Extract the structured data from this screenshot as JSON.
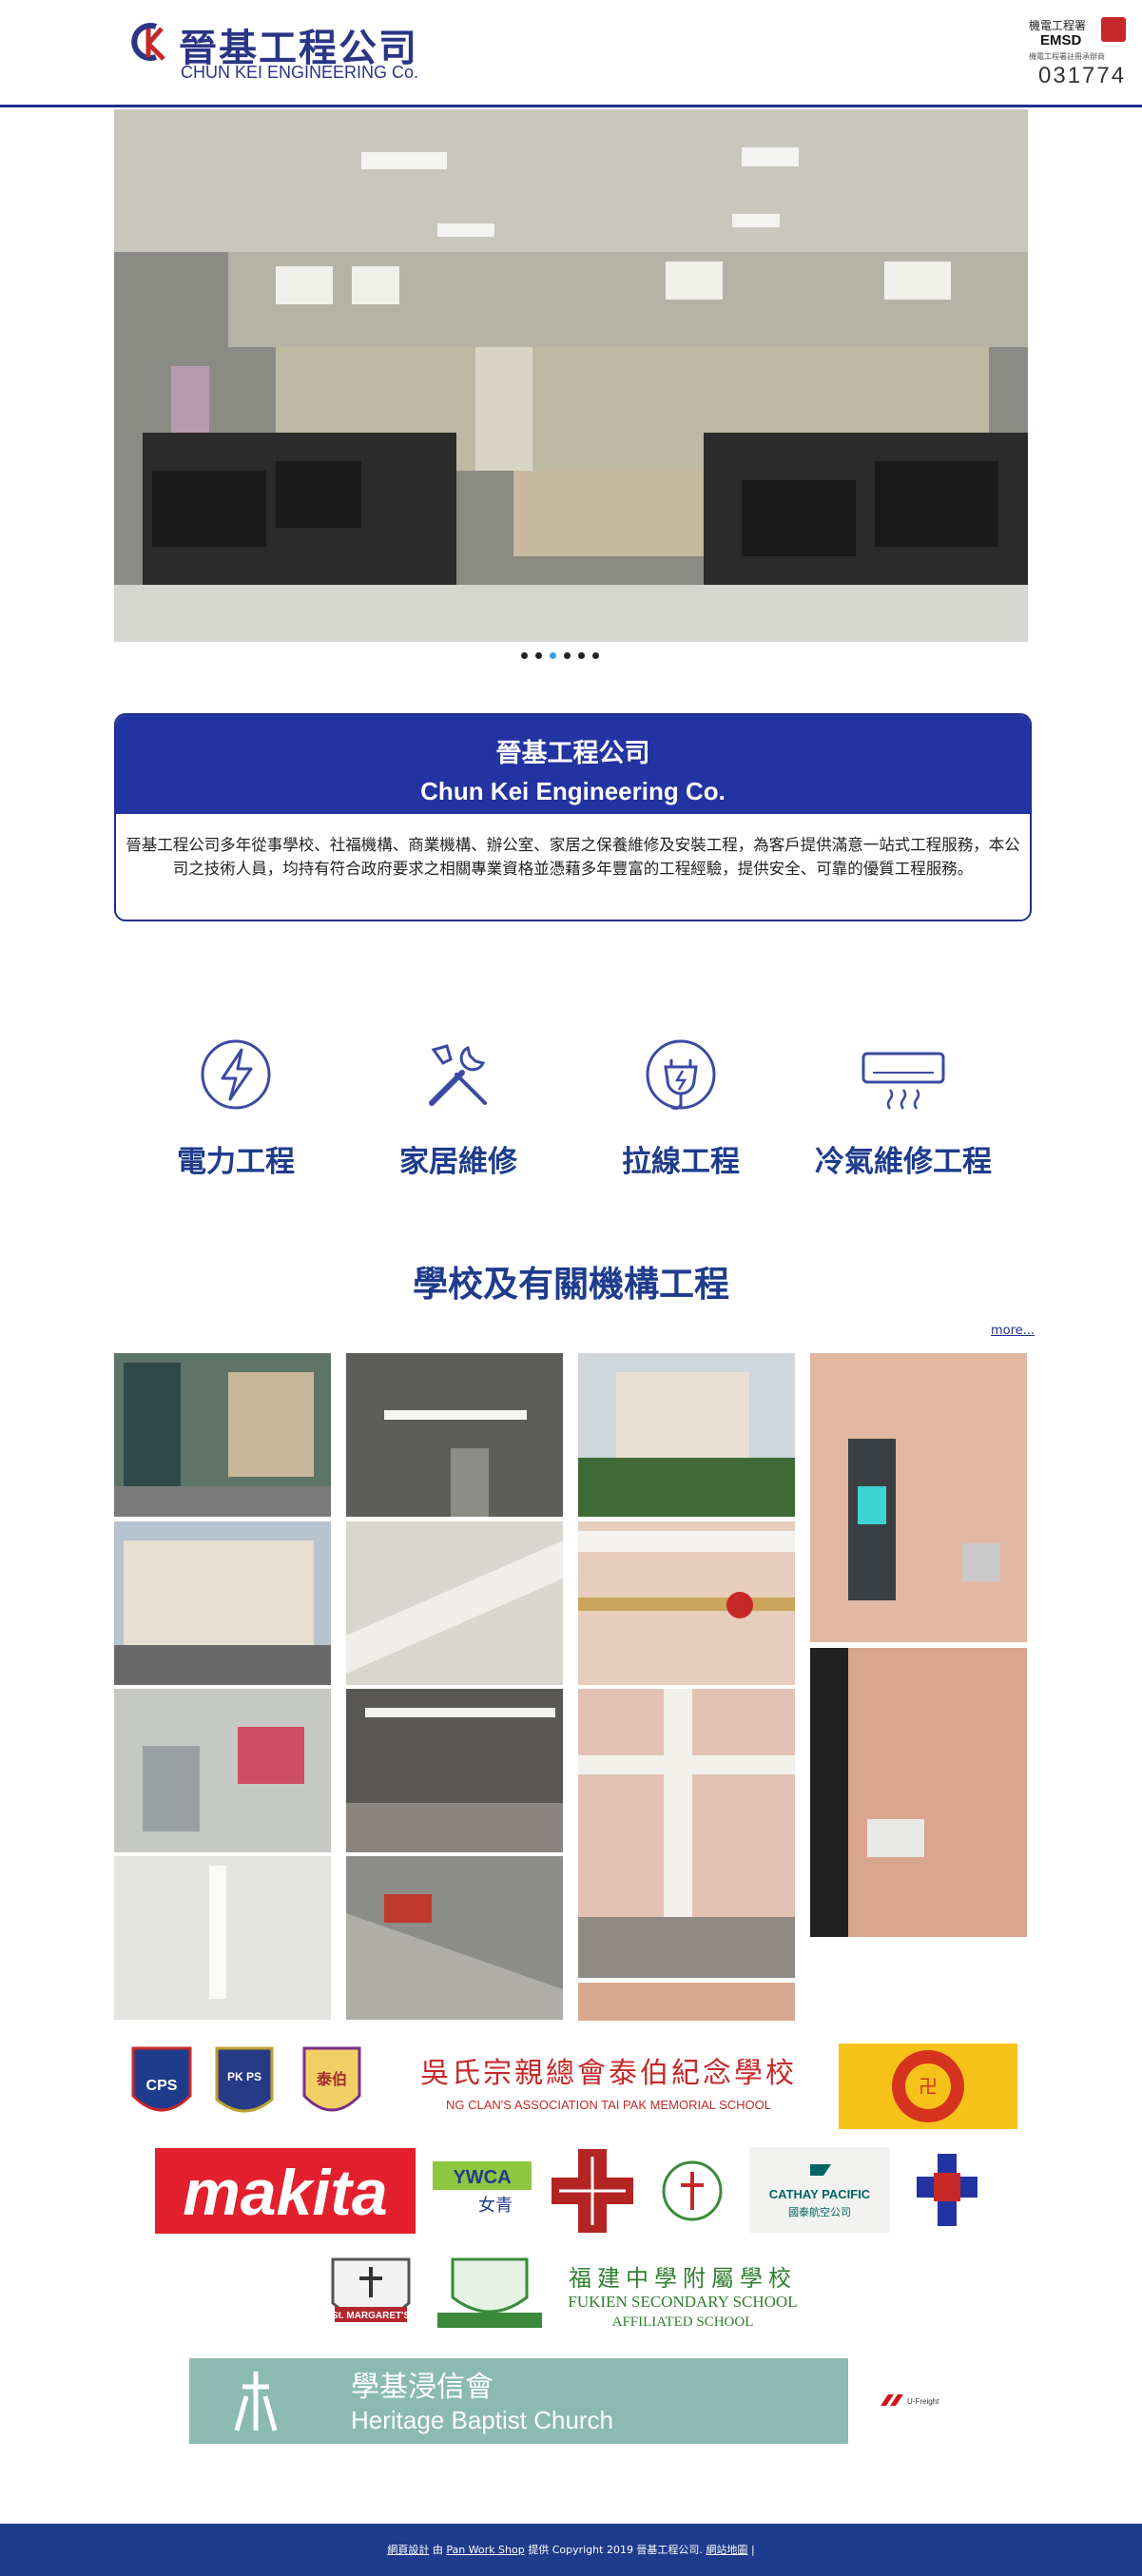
{
  "header": {
    "logo_cn": "晉基工程公司",
    "logo_en": "CHUN KEI ENGINEERING Co.",
    "emsd_line1": "機電工程署",
    "emsd_line2": "EMSD",
    "emsd_line3": "機電工程署註冊承辦商",
    "emsd_number": "031774"
  },
  "hero": {
    "dots": [
      false,
      false,
      true,
      false,
      false,
      false
    ]
  },
  "intro": {
    "title_cn": "晉基工程公司",
    "title_en": "Chun Kei Engineering Co.",
    "body": "晉基工程公司多年從事學校、社福機構、商業機構、辦公室、家居之保養維修及安裝工程，為客戶提供滿意一站式工程服務，本公司之技術人員，均持有符合政府要求之相關專業資格並憑藉多年豐富的工程經驗，提供安全、可靠的優質工程服務。"
  },
  "services": [
    {
      "label": "電力工程",
      "icon": "lightning-icon"
    },
    {
      "label": "家居維修",
      "icon": "tools-icon"
    },
    {
      "label": "拉線工程",
      "icon": "plug-icon"
    },
    {
      "label": "冷氣維修工程",
      "icon": "air-conditioner-icon"
    }
  ],
  "section": {
    "title": "學校及有關機構工程",
    "more": "more..."
  },
  "logos": {
    "cps": "CPS",
    "pkps": "PK PS",
    "taipak_cn": "泰伯",
    "ngclan_cn": "吳氏宗親總會泰伯紀念學校",
    "ngclan_en": "NG CLAN'S ASSOCIATION TAI PAK MEMORIAL SCHOOL",
    "makita": "makita",
    "ywca_en": "YWCA",
    "ywca_cn": "女青",
    "cathay_en": "CATHAY PACIFIC",
    "cathay_cn": "國泰航空公司",
    "st_margaret": "St. MARGARET'S",
    "fukien_cn": "福建中學附屬學校",
    "fukien_en1": "FUKIEN SECONDARY SCHOOL",
    "fukien_en2": "AFFILIATED SCHOOL",
    "heritage_cn": "學基浸信會",
    "heritage_en": "Heritage Baptist Church",
    "ufreight": "U-Freight"
  },
  "footer": {
    "design_link": "網頁設計",
    "by": "由",
    "pan_link": "Pan Work Shop",
    "text": "提供 Copyright 2019 晉基工程公司.",
    "sitemap_link": "網站地圖",
    "sep": "|"
  },
  "colors": {
    "brand_blue": "#2333a1",
    "title_blue": "#1f3c8c",
    "footer_blue": "#1f3c8c",
    "dot_active": "#3aa0e0"
  }
}
